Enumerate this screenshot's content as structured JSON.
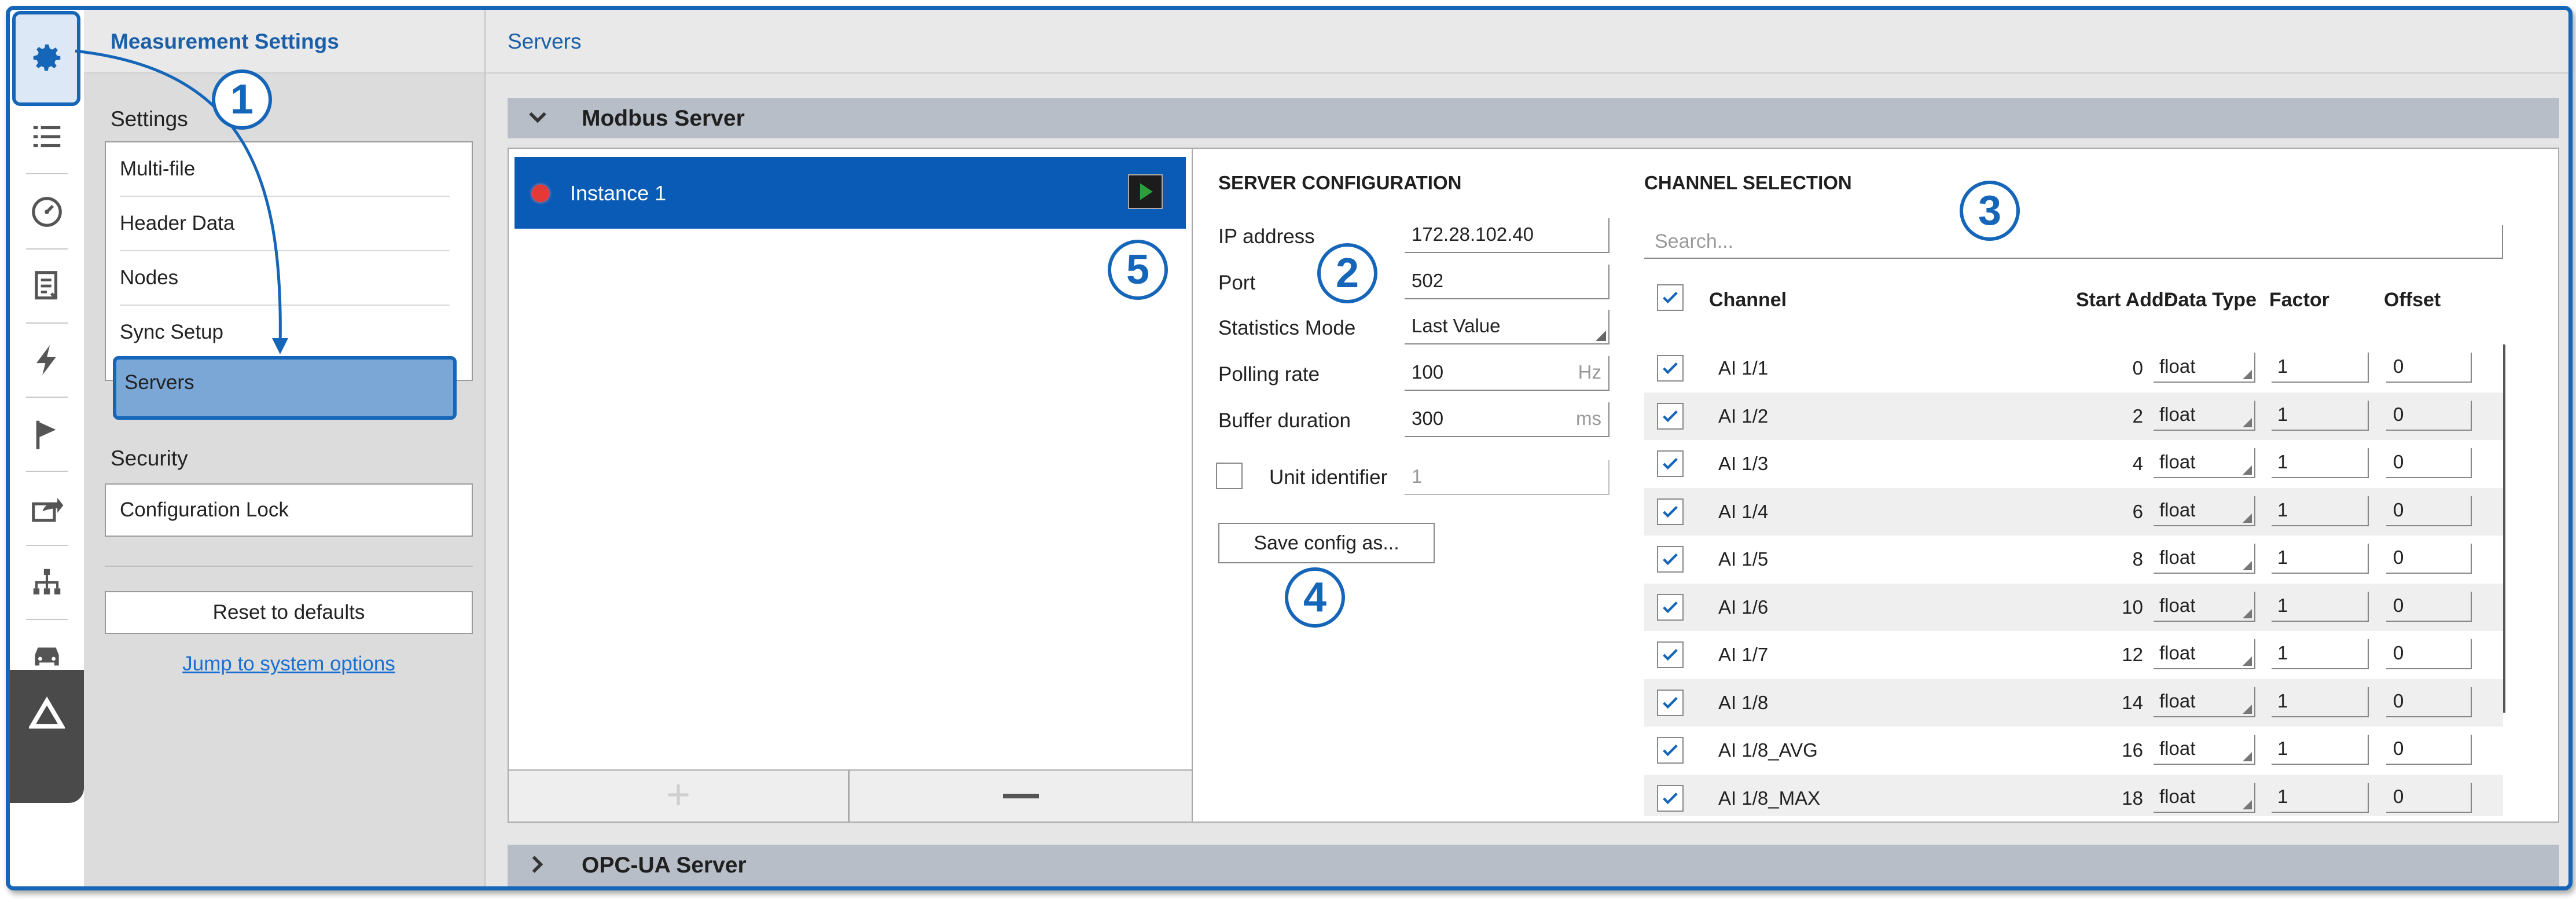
{
  "rail": {
    "icons": [
      "gear-icon",
      "list-icon",
      "gauge-icon",
      "report-icon",
      "lightning-icon",
      "flag-icon",
      "export-icon",
      "network-icon",
      "car-icon",
      "logo-icon"
    ]
  },
  "left_panel": {
    "title": "Measurement Settings",
    "settings_label": "Settings",
    "items": [
      {
        "label": "Multi-file"
      },
      {
        "label": "Header Data"
      },
      {
        "label": "Nodes"
      },
      {
        "label": "Sync Setup"
      },
      {
        "label": "Servers",
        "selected": true
      }
    ],
    "security_label": "Security",
    "config_lock": "Configuration Lock",
    "reset_button": "Reset to defaults",
    "system_link": "Jump to system options"
  },
  "main": {
    "title": "Servers",
    "sections": [
      {
        "label": "Modbus Server",
        "expanded": true
      },
      {
        "label": "OPC-UA Server",
        "expanded": false
      }
    ],
    "instances": [
      {
        "name": "Instance 1",
        "status_color": "#e53935",
        "selected": true
      }
    ],
    "add_symbol": "+",
    "server_config": {
      "caption": "SERVER CONFIGURATION",
      "ip_label": "IP address",
      "ip_value": "172.28.102.40",
      "port_label": "Port",
      "port_value": "502",
      "stats_label": "Statistics Mode",
      "stats_value": "Last Value",
      "polling_label": "Polling rate",
      "polling_value": "100",
      "polling_unit": "Hz",
      "buffer_label": "Buffer duration",
      "buffer_value": "300",
      "buffer_unit": "ms",
      "unit_id_label": "Unit identifier",
      "unit_id_value": "1",
      "unit_id_checked": false,
      "save_button": "Save config as..."
    },
    "channel_selection": {
      "caption": "CHANNEL SELECTION",
      "search_placeholder": "Search...",
      "headers": {
        "channel": "Channel",
        "start_addr": "Start Addr",
        "data_type": "Data Type",
        "factor": "Factor",
        "offset": "Offset"
      },
      "rows": [
        {
          "channel": "AI 1/1",
          "addr": "0",
          "type": "float",
          "factor": "1",
          "offset": "0",
          "checked": true
        },
        {
          "channel": "AI 1/2",
          "addr": "2",
          "type": "float",
          "factor": "1",
          "offset": "0",
          "checked": true
        },
        {
          "channel": "AI 1/3",
          "addr": "4",
          "type": "float",
          "factor": "1",
          "offset": "0",
          "checked": true
        },
        {
          "channel": "AI 1/4",
          "addr": "6",
          "type": "float",
          "factor": "1",
          "offset": "0",
          "checked": true
        },
        {
          "channel": "AI 1/5",
          "addr": "8",
          "type": "float",
          "factor": "1",
          "offset": "0",
          "checked": true
        },
        {
          "channel": "AI 1/6",
          "addr": "10",
          "type": "float",
          "factor": "1",
          "offset": "0",
          "checked": true
        },
        {
          "channel": "AI 1/7",
          "addr": "12",
          "type": "float",
          "factor": "1",
          "offset": "0",
          "checked": true
        },
        {
          "channel": "AI 1/8",
          "addr": "14",
          "type": "float",
          "factor": "1",
          "offset": "0",
          "checked": true
        },
        {
          "channel": "AI 1/8_AVG",
          "addr": "16",
          "type": "float",
          "factor": "1",
          "offset": "0",
          "checked": true
        },
        {
          "channel": "AI 1/8_MAX",
          "addr": "18",
          "type": "float",
          "factor": "1",
          "offset": "0",
          "checked": true
        }
      ]
    }
  },
  "callouts": [
    "1",
    "2",
    "3",
    "4",
    "5"
  ],
  "colors": {
    "accent": "#1565b8",
    "selected_bg": "#0a5bb5",
    "nav_selected": "#7ba7d6",
    "status_red": "#e53935"
  }
}
